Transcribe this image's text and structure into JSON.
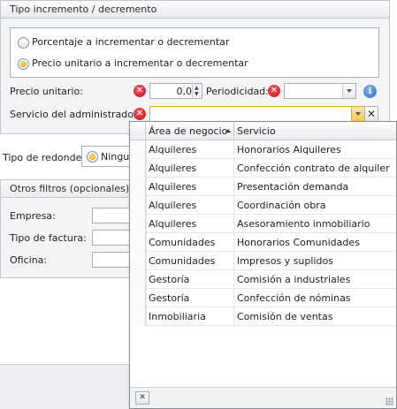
{
  "increment_group": {
    "title": "Tipo incremento / decremento",
    "options": [
      {
        "label": "Porcentaje a incrementar o decrementar",
        "checked": false
      },
      {
        "label": "Precio unitario a incrementar o decrementar",
        "checked": true
      }
    ]
  },
  "fields": {
    "precio_label": "Precio unitario:",
    "precio_value": "0,00",
    "periodicidad_label": "Periodicidad:",
    "periodicidad_value": "",
    "servicio_label": "Servicio del administrador:",
    "servicio_value": "",
    "redondeo_label": "Tipo de redondeo:",
    "redondeo_value": "Ningun"
  },
  "filters": {
    "title": "Otros filtros (opcionales):",
    "empresa_label": "Empresa:",
    "tipo_factura_label": "Tipo de factura:",
    "oficina_label": "Oficina:"
  },
  "popup": {
    "columns": [
      "Área de negocio",
      "Servicio"
    ],
    "sort_column": "Área de negocio",
    "sort_direction": "ascending",
    "rows": [
      {
        "area": "Alquileres",
        "servicio": "Honorarios Alquileres"
      },
      {
        "area": "Alquileres",
        "servicio": "Confección contrato de alquiler"
      },
      {
        "area": "Alquileres",
        "servicio": "Presentación demanda"
      },
      {
        "area": "Alquileres",
        "servicio": "Coordinación obra"
      },
      {
        "area": "Alquileres",
        "servicio": "Asesoramiento inmobiliario"
      },
      {
        "area": "Comunidades",
        "servicio": "Honorarios Comunidades"
      },
      {
        "area": "Comunidades",
        "servicio": "Impresos y suplidos"
      },
      {
        "area": "Gestoría",
        "servicio": "Comisión a industriales"
      },
      {
        "area": "Gestoría",
        "servicio": "Confección de nóminas"
      },
      {
        "area": "Inmobiliaria",
        "servicio": "Comisión de ventas"
      }
    ]
  },
  "icons": {
    "error": "error-icon",
    "info": "info-icon",
    "clear": "clear-icon",
    "dropdown": "chevron-down-icon"
  },
  "colors": {
    "error": "#d0191f",
    "info": "#2f6fc6",
    "radio_checked": "#f0b11a",
    "active_dropdown": "#f8c94a"
  }
}
